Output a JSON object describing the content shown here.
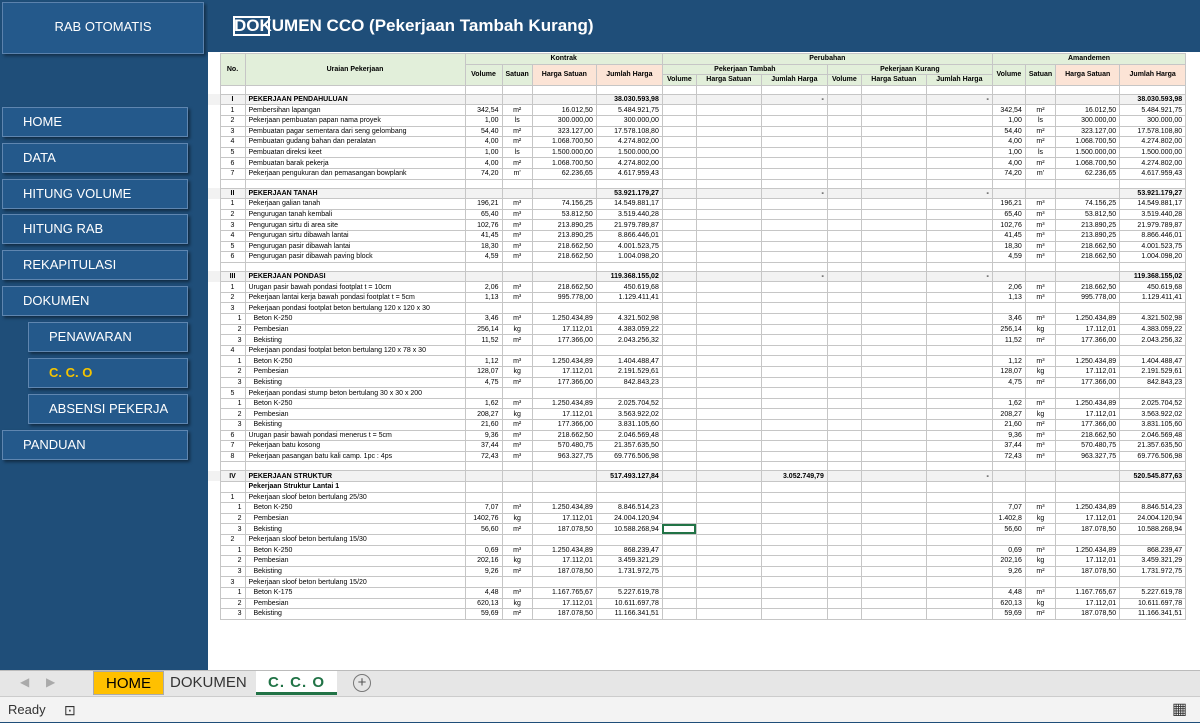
{
  "app_title": "RAB OTOMATIS",
  "doc_title": "DOKUMEN CCO (Pekerjaan Tambah Kurang)",
  "nav": {
    "home": "HOME",
    "data": "DATA",
    "hitung_volume": "HITUNG VOLUME",
    "hitung_rab": "HITUNG RAB",
    "rekapitulasi": "REKAPITULASI",
    "dokumen": "DOKUMEN",
    "penawaran": "PENAWARAN",
    "cco": "C. C. O",
    "absensi": "ABSENSI PEKERJA",
    "panduan": "PANDUAN"
  },
  "headers": {
    "no": "No.",
    "uraian": "Uraian Pekerjaan",
    "kontrak": "Kontrak",
    "perubahan": "Perubahan",
    "amandemen": "Amandemen",
    "tambah": "Pekerjaan Tambah",
    "kurang": "Pekerjaan Kurang",
    "volume": "Volume",
    "satuan": "Satuan",
    "harga_satuan": "Harga Satuan",
    "jumlah_harga": "Jumlah Harga"
  },
  "rows": [
    {
      "t": "blank"
    },
    {
      "t": "sec",
      "no": "I",
      "name": "PEKERJAAN PENDAHULUAN",
      "kj": "38.030.593,98",
      "pt": "-",
      "pk": "-",
      "aj": "38.030.593,98"
    },
    {
      "t": "item",
      "no": "1",
      "name": "Pembersihan lapangan",
      "vol": "342,54",
      "sat": "m²",
      "hs": "16.012,50",
      "jh": "5.484.921,75"
    },
    {
      "t": "item",
      "no": "2",
      "name": "Pekerjaan pembuatan papan nama proyek",
      "vol": "1,00",
      "sat": "ls",
      "hs": "300.000,00",
      "jh": "300.000,00"
    },
    {
      "t": "item",
      "no": "3",
      "name": "Pembuatan pagar sementara dari seng gelombang",
      "vol": "54,40",
      "sat": "m²",
      "hs": "323.127,00",
      "jh": "17.578.108,80"
    },
    {
      "t": "item",
      "no": "4",
      "name": "Pembuatan gudang bahan dan peralatan",
      "vol": "4,00",
      "sat": "m²",
      "hs": "1.068.700,50",
      "jh": "4.274.802,00"
    },
    {
      "t": "item",
      "no": "5",
      "name": "Pembuatan direksi keet",
      "vol": "1,00",
      "sat": "ls",
      "hs": "1.500.000,00",
      "jh": "1.500.000,00"
    },
    {
      "t": "item",
      "no": "6",
      "name": "Pembuatan barak pekerja",
      "vol": "4,00",
      "sat": "m²",
      "hs": "1.068.700,50",
      "jh": "4.274.802,00"
    },
    {
      "t": "item",
      "no": "7",
      "name": "Pekerjaan pengukuran dan pemasangan bowplank",
      "vol": "74,20",
      "sat": "m'",
      "hs": "62.236,65",
      "jh": "4.617.959,43"
    },
    {
      "t": "blank"
    },
    {
      "t": "sec",
      "no": "II",
      "name": "PEKERJAAN TANAH",
      "kj": "53.921.179,27",
      "pt": "-",
      "pk": "-",
      "aj": "53.921.179,27"
    },
    {
      "t": "item",
      "no": "1",
      "name": "Pekerjaan galian tanah",
      "vol": "196,21",
      "sat": "m³",
      "hs": "74.156,25",
      "jh": "14.549.881,17"
    },
    {
      "t": "item",
      "no": "2",
      "name": "Pengurugan tanah kembali",
      "vol": "65,40",
      "sat": "m³",
      "hs": "53.812,50",
      "jh": "3.519.440,28"
    },
    {
      "t": "item",
      "no": "3",
      "name": "Pengurugan sirtu di area site",
      "vol": "102,76",
      "sat": "m³",
      "hs": "213.890,25",
      "jh": "21.979.789,87"
    },
    {
      "t": "item",
      "no": "4",
      "name": "Pengurugan sirtu dibawah lantai",
      "vol": "41,45",
      "sat": "m³",
      "hs": "213.890,25",
      "jh": "8.866.446,01"
    },
    {
      "t": "item",
      "no": "5",
      "name": "Pengurugan pasir dibawah lantai",
      "vol": "18,30",
      "sat": "m³",
      "hs": "218.662,50",
      "jh": "4.001.523,75"
    },
    {
      "t": "item",
      "no": "6",
      "name": "Pengurugan pasir dibawah paving block",
      "vol": "4,59",
      "sat": "m³",
      "hs": "218.662,50",
      "jh": "1.004.098,20"
    },
    {
      "t": "blank"
    },
    {
      "t": "sec",
      "no": "III",
      "name": "PEKERJAAN PONDASI",
      "kj": "119.368.155,02",
      "pt": "-",
      "pk": "-",
      "aj": "119.368.155,02"
    },
    {
      "t": "item",
      "no": "1",
      "name": "Urugan pasir bawah pondasi footplat t = 10cm",
      "vol": "2,06",
      "sat": "m³",
      "hs": "218.662,50",
      "jh": "450.619,68"
    },
    {
      "t": "item",
      "no": "2",
      "name": "Pekerjaan lantai kerja bawah pondasi footplat t = 5cm",
      "vol": "1,13",
      "sat": "m³",
      "hs": "995.778,00",
      "jh": "1.129.411,41"
    },
    {
      "t": "group",
      "no": "3",
      "name": "Pekerjaan pondasi footplat beton bertulang 120 x 120 x 30"
    },
    {
      "t": "sub",
      "no": "1",
      "name": "Beton K-250",
      "vol": "3,46",
      "sat": "m³",
      "hs": "1.250.434,89",
      "jh": "4.321.502,98"
    },
    {
      "t": "sub",
      "no": "2",
      "name": "Pembesian",
      "vol": "256,14",
      "sat": "kg",
      "hs": "17.112,01",
      "jh": "4.383.059,22"
    },
    {
      "t": "sub",
      "no": "3",
      "name": "Bekisting",
      "vol": "11,52",
      "sat": "m²",
      "hs": "177.366,00",
      "jh": "2.043.256,32"
    },
    {
      "t": "group",
      "no": "4",
      "name": "Pekerjaan pondasi footplat beton bertulang 120 x 78 x 30"
    },
    {
      "t": "sub",
      "no": "1",
      "name": "Beton K-250",
      "vol": "1,12",
      "sat": "m³",
      "hs": "1.250.434,89",
      "jh": "1.404.488,47"
    },
    {
      "t": "sub",
      "no": "2",
      "name": "Pembesian",
      "vol": "128,07",
      "sat": "kg",
      "hs": "17.112,01",
      "jh": "2.191.529,61"
    },
    {
      "t": "sub",
      "no": "3",
      "name": "Bekisting",
      "vol": "4,75",
      "sat": "m²",
      "hs": "177.366,00",
      "jh": "842.843,23"
    },
    {
      "t": "group",
      "no": "5",
      "name": "Pekerjaan pondasi stump beton bertulang 30 x 30 x 200"
    },
    {
      "t": "sub",
      "no": "1",
      "name": "Beton K-250",
      "vol": "1,62",
      "sat": "m³",
      "hs": "1.250.434,89",
      "jh": "2.025.704,52"
    },
    {
      "t": "sub",
      "no": "2",
      "name": "Pembesian",
      "vol": "208,27",
      "sat": "kg",
      "hs": "17.112,01",
      "jh": "3.563.922,02"
    },
    {
      "t": "sub",
      "no": "3",
      "name": "Bekisting",
      "vol": "21,60",
      "sat": "m²",
      "hs": "177.366,00",
      "jh": "3.831.105,60"
    },
    {
      "t": "item",
      "no": "6",
      "name": "Urugan pasir bawah pondasi menerus t = 5cm",
      "vol": "9,36",
      "sat": "m³",
      "hs": "218.662,50",
      "jh": "2.046.569,48"
    },
    {
      "t": "item",
      "no": "7",
      "name": "Pekerjaan batu kosong",
      "vol": "37,44",
      "sat": "m³",
      "hs": "570.480,75",
      "jh": "21.357.635,50"
    },
    {
      "t": "item",
      "no": "8",
      "name": "Pekerjaan pasangan batu kali camp. 1pc : 4ps",
      "vol": "72,43",
      "sat": "m³",
      "hs": "963.327,75",
      "jh": "69.776.506,98"
    },
    {
      "t": "blank"
    },
    {
      "t": "sec",
      "no": "IV",
      "name": "PEKERJAAN STRUKTUR",
      "kj": "517.493.127,84",
      "pt": "3.052.749,79",
      "pk": "-",
      "aj": "520.545.877,63"
    },
    {
      "t": "group",
      "no": "",
      "name": "Pekerjaan Struktur Lantai 1",
      "bold": true
    },
    {
      "t": "group",
      "no": "1",
      "name": "Pekerjaan sloof beton bertulang 25/30"
    },
    {
      "t": "sub",
      "no": "1",
      "name": "Beton K-250",
      "vol": "7,07",
      "sat": "m³",
      "hs": "1.250.434,89",
      "jh": "8.846.514,23"
    },
    {
      "t": "sub",
      "no": "2",
      "name": "Pembesian",
      "vol": "1402,76",
      "sat": "kg",
      "hs": "17.112,01",
      "jh": "24.004.120,94",
      "avol": "1.402,8"
    },
    {
      "t": "sub",
      "no": "3",
      "name": "Bekisting",
      "vol": "56,60",
      "sat": "m²",
      "hs": "187.078,50",
      "jh": "10.588.268,94",
      "sel": true
    },
    {
      "t": "group",
      "no": "2",
      "name": "Pekerjaan sloof beton bertulang 15/30"
    },
    {
      "t": "sub",
      "no": "1",
      "name": "Beton K-250",
      "vol": "0,69",
      "sat": "m³",
      "hs": "1.250.434,89",
      "jh": "868.239,47"
    },
    {
      "t": "sub",
      "no": "2",
      "name": "Pembesian",
      "vol": "202,16",
      "sat": "kg",
      "hs": "17.112,01",
      "jh": "3.459.321,29"
    },
    {
      "t": "sub",
      "no": "3",
      "name": "Bekisting",
      "vol": "9,26",
      "sat": "m²",
      "hs": "187.078,50",
      "jh": "1.731.972,75"
    },
    {
      "t": "group",
      "no": "3",
      "name": "Pekerjaan sloof beton bertulang 15/20"
    },
    {
      "t": "sub",
      "no": "1",
      "name": "Beton K-175",
      "vol": "4,48",
      "sat": "m³",
      "hs": "1.167.765,67",
      "jh": "5.227.619,78"
    },
    {
      "t": "sub",
      "no": "2",
      "name": "Pembesian",
      "vol": "620,13",
      "sat": "kg",
      "hs": "17.112,01",
      "jh": "10.611.697,78"
    },
    {
      "t": "sub",
      "no": "3",
      "name": "Bekisting",
      "vol": "59,69",
      "sat": "m²",
      "hs": "187.078,50",
      "jh": "11.166.341,51"
    }
  ],
  "tabs": {
    "home": "HOME",
    "dokumen": "DOKUMEN",
    "cco": "C. C. O",
    "add": "+"
  },
  "status": {
    "ready": "Ready"
  }
}
